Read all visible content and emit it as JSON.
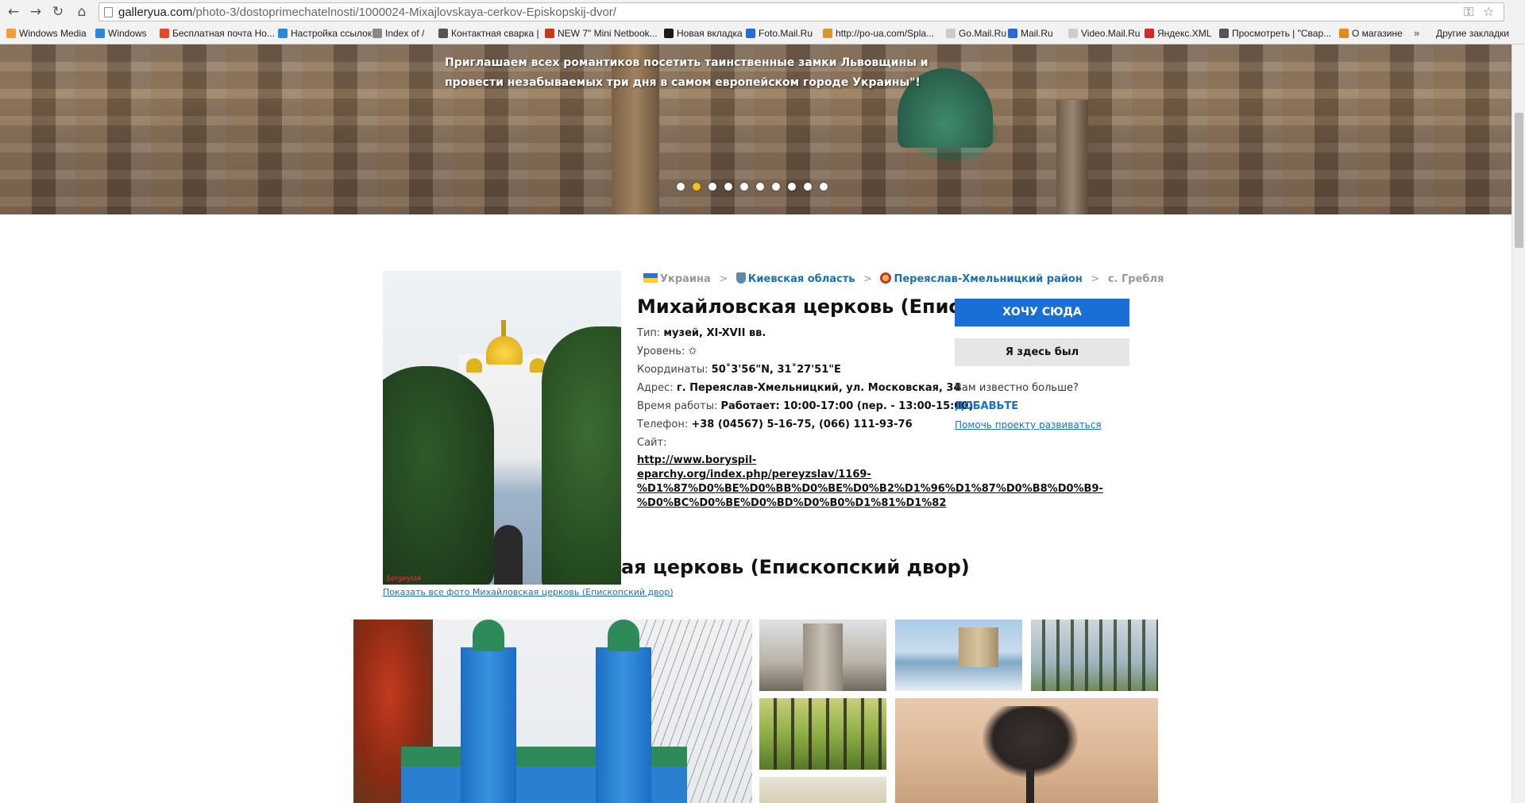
{
  "browser": {
    "url_host": "galleryua.com",
    "url_path": "/photo-3/dostoprimechatelnosti/1000024-Mixajlovskaya-cerkov-Episkopskij-dvor/",
    "bookmarks": [
      {
        "label": "Windows Media",
        "color": "#f0a030"
      },
      {
        "label": "Windows",
        "color": "#2a8ad4"
      },
      {
        "label": "Бесплатная почта Но...",
        "color": "#e34a2a"
      },
      {
        "label": "Настройка ссылок",
        "color": "#2a8ad4"
      },
      {
        "label": "Index of /",
        "color": "#888888"
      },
      {
        "label": "Контактная сварка |",
        "color": "#555555"
      },
      {
        "label": "NEW 7\" Mini Netbook...",
        "color": "#c43a1a"
      },
      {
        "label": "Новая вкладка",
        "color": "#1a1a1a"
      },
      {
        "label": "Foto.Mail.Ru",
        "color": "#2a6ad4"
      },
      {
        "label": "http://po-ua.com/Spla...",
        "color": "#d49a2a"
      },
      {
        "label": "Go.Mail.Ru",
        "color": "#cccccc"
      },
      {
        "label": "Mail.Ru",
        "color": "#2a6ad4"
      },
      {
        "label": "Video.Mail.Ru",
        "color": "#cccccc"
      },
      {
        "label": "Яндекс.XML",
        "color": "#d42a2a"
      },
      {
        "label": "Просмотреть | \"Свар...",
        "color": "#555555"
      },
      {
        "label": "О магазине",
        "color": "#e38a1a"
      }
    ],
    "bookmarks_more": "»",
    "other_bookmarks": "Другие закладки"
  },
  "hero": {
    "text": "Приглашаем всех романтиков посетить таинственные замки Львовщины и провести незабываемых три дня в самом европейском городе Украины\"!",
    "dot_count": 10,
    "active_dot": 1
  },
  "breadcrumb": {
    "country": "Украина",
    "region": "Киевская область",
    "district": "Переяслав-Хмельницкий район",
    "village": "с. Гребля",
    "separator": ">"
  },
  "place": {
    "title": "Михайловская церковь (Епископский двор)",
    "type_label": "Тип:",
    "type_value": "музей, XI-XVII вв.",
    "level_label": "Уровень:",
    "level_value": "✩",
    "coords_label": "Координаты:",
    "coords_value": "50˚3'56\"N, 31˚27'51\"E",
    "address_label": "Адрес:",
    "address_value": "г. Переяслав-Хмельницкий, ул. Московская, 34",
    "hours_label": "Время работы:",
    "hours_value": "Работает: 10:00-17:00 (пер. - 13:00-15:00)",
    "phone_label": "Телефон:",
    "phone_value": "+38 (04567) 5-16-75, (066) 111-93-76",
    "site_label": "Сайт:",
    "site_lines": [
      "http://www.boryspil-",
      "eparchy.org/index.php/pereyzslav/1169-",
      "%D1%87%D0%BE%D0%BB%D0%BE%D0%B2%D1%96%D1%87%D0%B8%D0%B9-",
      "%D0%BC%D0%BE%D0%BD%D0%B0%D1%81%D1%82"
    ],
    "photo_watermark": "SergeyUA"
  },
  "actions": {
    "want_label": "ХОЧУ СЮДА",
    "been_label": "Я здесь был",
    "know_more": "Вам известно больше?",
    "add_label": "ДОБАВЬТЕ",
    "help_label": "Помочь проекту развиваться"
  },
  "gallery": {
    "section_title": "ая церковь (Епископский двор)",
    "show_all": "Показать все фото Михайловская церковь (Епископский двор)"
  }
}
